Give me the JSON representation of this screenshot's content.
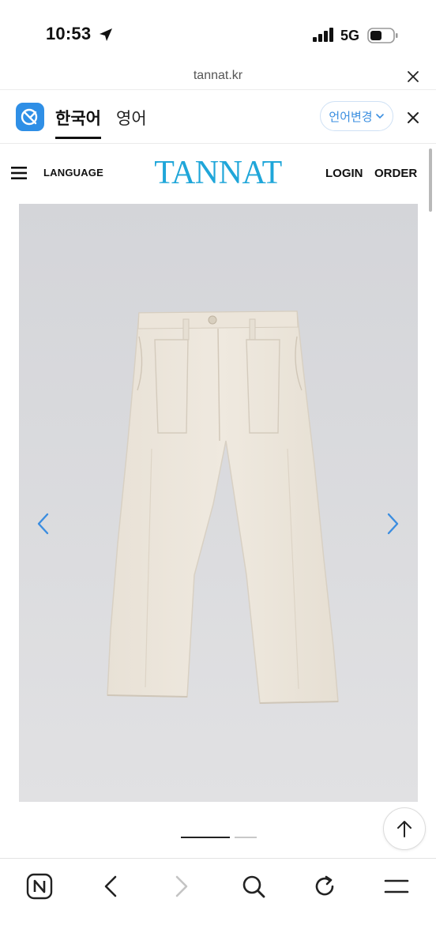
{
  "status_bar": {
    "time": "10:53",
    "network": "5G",
    "icons": [
      "location-arrow-icon",
      "signal-icon",
      "battery-icon"
    ]
  },
  "browser": {
    "url": "tannat.kr"
  },
  "translate_bar": {
    "source_lang": "한국어",
    "target_lang": "영어",
    "change_label": "언어변경",
    "accent_color": "#3a8ee0"
  },
  "site": {
    "language_label": "LANGUAGE",
    "brand": "TANNAT",
    "brand_color": "#1fa6d9",
    "login_label": "LOGIN",
    "order_label": "ORDER"
  },
  "gallery": {
    "slide_count": 2,
    "active_index": 0,
    "arrow_color": "#3b8de0"
  },
  "toolbar": {
    "items": [
      "naver-home-icon",
      "back-icon",
      "forward-icon",
      "search-icon",
      "reload-icon",
      "menu-icon"
    ]
  }
}
